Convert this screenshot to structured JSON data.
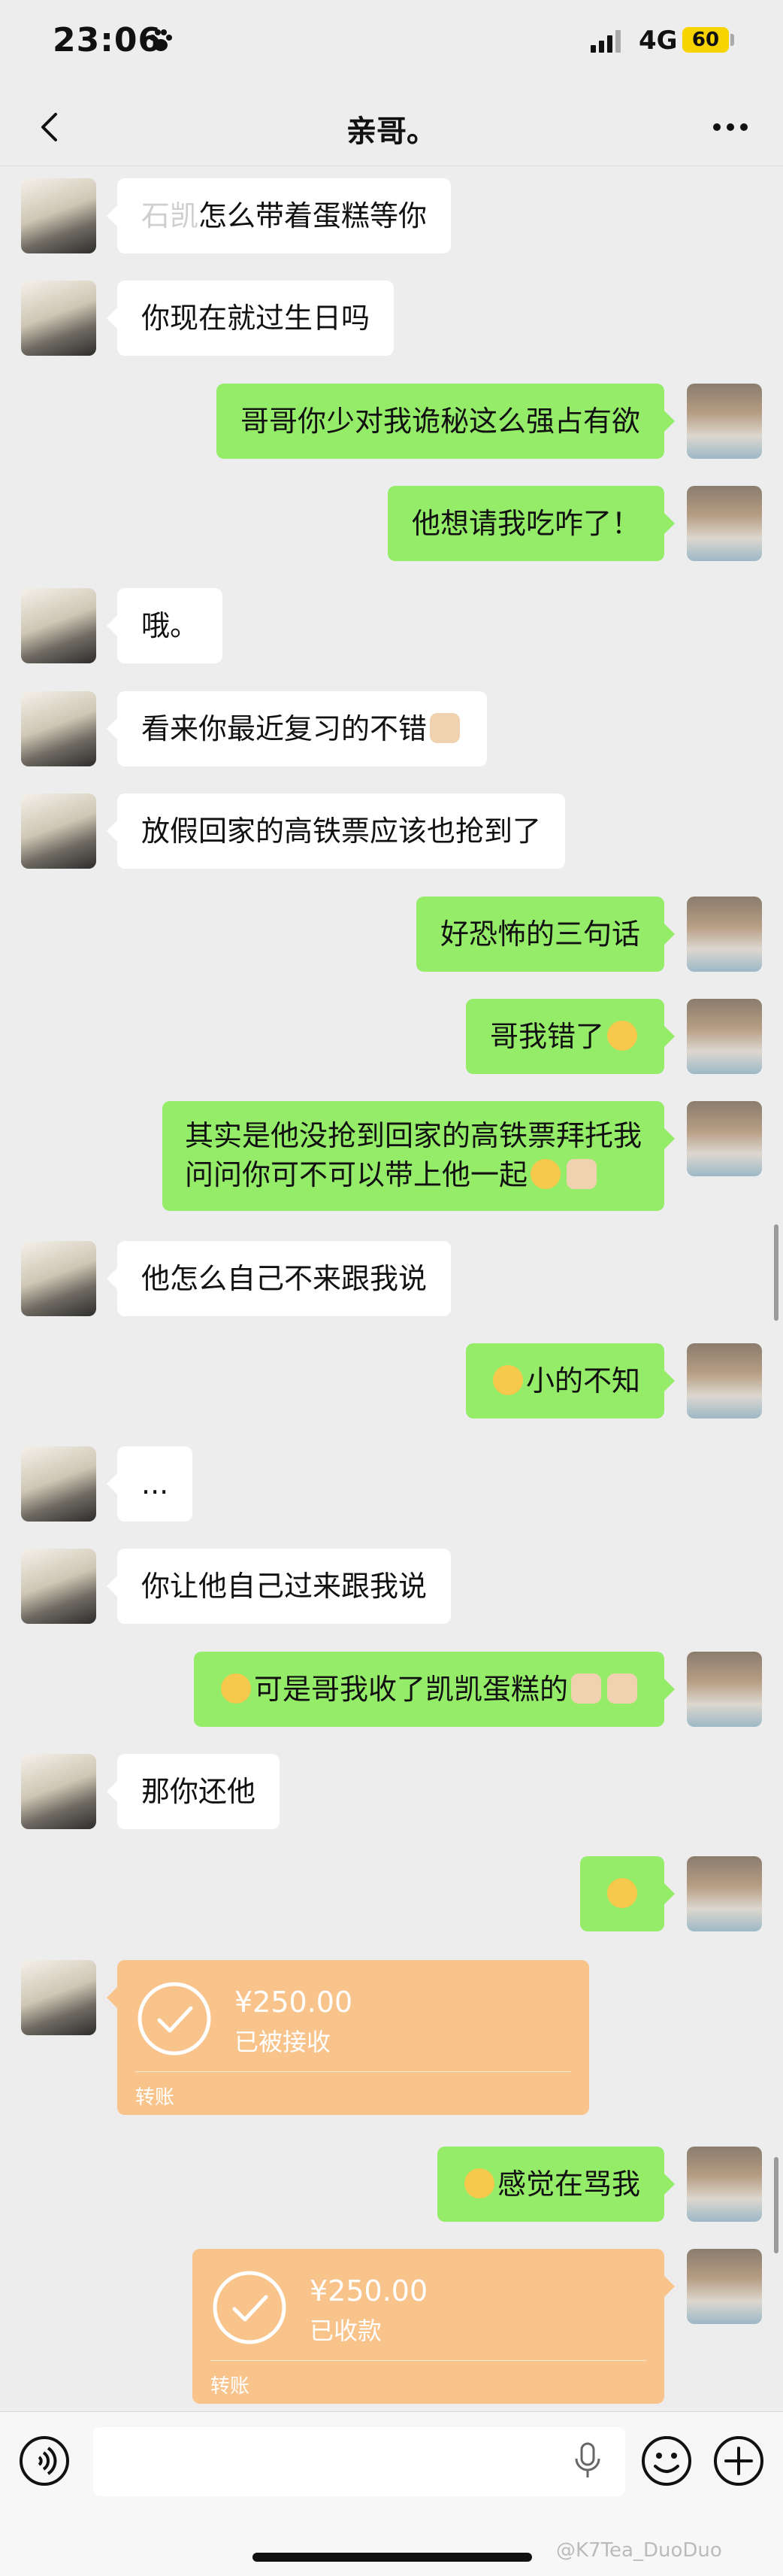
{
  "status_bar": {
    "time": "23:06",
    "network": "4G",
    "battery": "60"
  },
  "nav": {
    "title": "亲哥。"
  },
  "messages": [
    {
      "side": "left",
      "text_faded": "石凯",
      "text": "怎么带着蛋糕等你"
    },
    {
      "side": "left",
      "text": "你现在就过生日吗"
    },
    {
      "side": "right",
      "text": "哥哥你少对我诡秘这么强占有欲"
    },
    {
      "side": "right",
      "text": "他想请我吃咋了！"
    },
    {
      "side": "left",
      "text": "哦。"
    },
    {
      "side": "left",
      "text": "看来你最近复习的不错"
    },
    {
      "side": "left",
      "text": "放假回家的高铁票应该也抢到了"
    },
    {
      "side": "right",
      "text": "好恐怖的三句话"
    },
    {
      "side": "right",
      "text": "哥我错了"
    },
    {
      "side": "right",
      "line1": "其实是他没抢到回家的高铁票拜托我",
      "line2": "问问你可不可以带上他一起"
    },
    {
      "side": "left",
      "text": "他怎么自己不来跟我说"
    },
    {
      "side": "right",
      "text": "小的不知"
    },
    {
      "side": "left",
      "text": "..."
    },
    {
      "side": "left",
      "text": "你让他自己过来跟我说"
    },
    {
      "side": "right",
      "text": "可是哥我收了凯凯蛋糕的"
    },
    {
      "side": "left",
      "text": "那你还他"
    },
    {
      "side": "right",
      "text": ""
    },
    {
      "side": "right",
      "text": "感觉在骂我"
    }
  ],
  "transfers": [
    {
      "side": "left",
      "amount": "¥250.00",
      "state": "已被接收",
      "label": "转账"
    },
    {
      "side": "right",
      "amount": "¥250.00",
      "state": "已收款",
      "label": "转账"
    }
  ],
  "input": {
    "placeholder": ""
  },
  "watermark": "@K7Tea_DuoDuo",
  "colors": {
    "self_bubble": "#95ec69",
    "other_bubble": "#ffffff",
    "transfer": "#f8c48c",
    "background": "#ededed"
  }
}
